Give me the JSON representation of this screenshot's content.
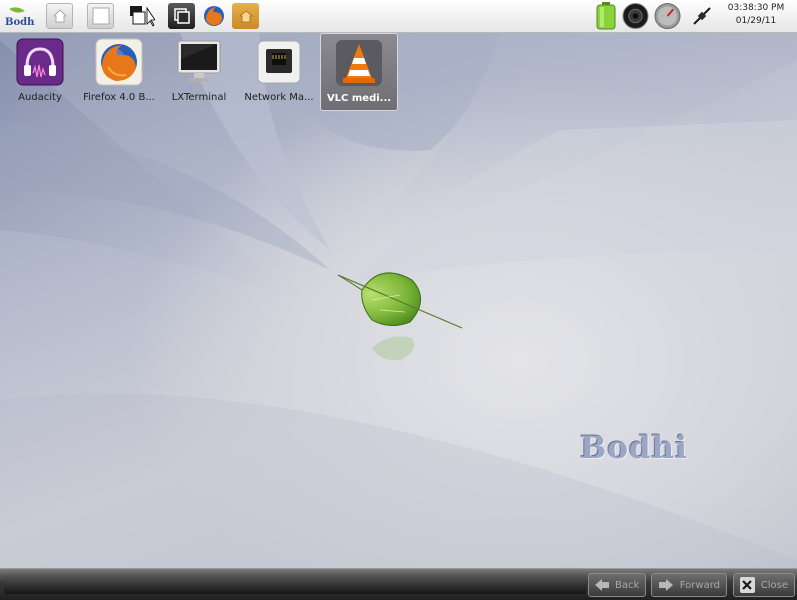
{
  "top_panel": {
    "launcher_logo_label": "Bodhi",
    "launchers": [
      {
        "name": "home-icon"
      },
      {
        "name": "blank-window-icon"
      },
      {
        "name": "pager-icon"
      },
      {
        "name": "window-switch-icon"
      },
      {
        "name": "firefox-icon"
      },
      {
        "name": "folder-home-icon"
      }
    ],
    "tray": [
      {
        "name": "battery-icon"
      },
      {
        "name": "volume-icon"
      },
      {
        "name": "cpu-gauge-icon"
      },
      {
        "name": "network-plug-icon"
      }
    ],
    "clock": {
      "time": "03:38:30 PM",
      "date": "01/29/11"
    }
  },
  "desktop_icons": [
    {
      "label": "Audacity",
      "icon": "audacity-icon",
      "selected": false
    },
    {
      "label": "Firefox 4.0 B...",
      "icon": "firefox-icon",
      "selected": false
    },
    {
      "label": "LXTerminal",
      "icon": "terminal-icon",
      "selected": false
    },
    {
      "label": "Network Ma...",
      "icon": "network-manager-icon",
      "selected": false
    },
    {
      "label": "VLC medi...",
      "icon": "vlc-icon",
      "selected": true
    }
  ],
  "wallpaper": {
    "watermark": "Bodhi",
    "accent_leaf": "#7fb83a"
  },
  "bottom_bar": {
    "back_label": "Back",
    "forward_label": "Forward",
    "close_label": "Close"
  }
}
